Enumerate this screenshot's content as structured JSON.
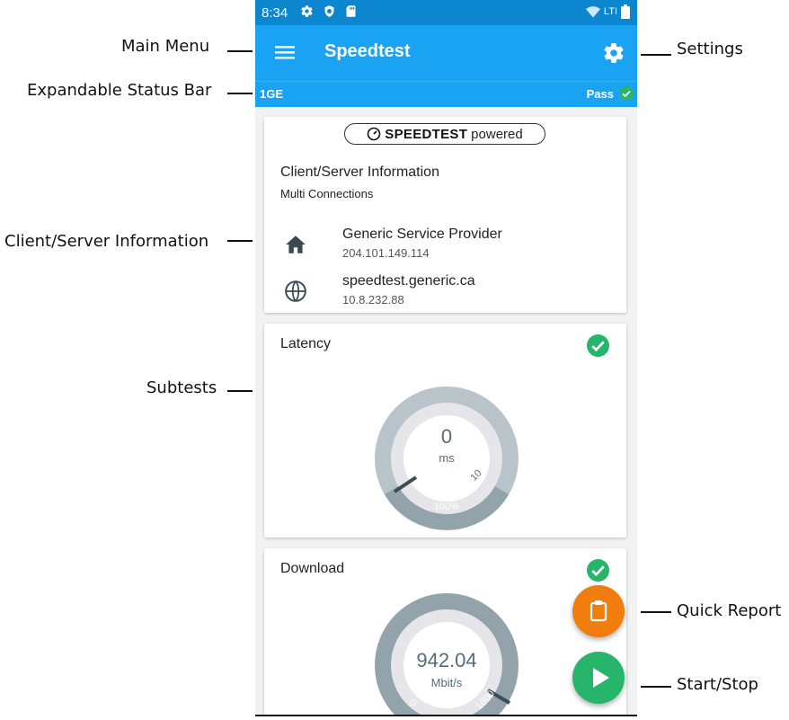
{
  "callouts": {
    "main_menu": "Main Menu",
    "settings": "Settings",
    "expandable_status_bar": "Expandable Status Bar",
    "client_server_information": "Client/Server Information",
    "subtests": "Subtests",
    "quick_report": "Quick Report",
    "start_stop": "Start/Stop"
  },
  "status_bar": {
    "time": "8:34",
    "icons": [
      "gear-icon",
      "shield-icon",
      "sd-card-icon"
    ],
    "network": "LTI",
    "right_icons": [
      "wifi-icon",
      "battery-icon"
    ]
  },
  "app_bar": {
    "title": "Speedtest",
    "menu_icon": "menu-icon",
    "settings_icon": "gear-icon"
  },
  "status_strip": {
    "left": "1GE",
    "right": "Pass"
  },
  "info_card": {
    "logo_brand": "SPEEDTEST",
    "logo_suffix": "powered",
    "title": "Client/Server Information",
    "subtitle": "Multi Connections",
    "client": {
      "name": "Generic Service Provider",
      "ip": "204.101.149.114",
      "icon": "home-icon"
    },
    "server": {
      "name": "speedtest.generic.ca",
      "ip": "10.8.232.88",
      "icon": "globe-icon"
    }
  },
  "latency_card": {
    "title": "Latency",
    "value": "0",
    "unit": "ms",
    "threshold_label": "10",
    "percent_label": "100%",
    "colors": {
      "track": "#b8c4c9",
      "inner": "#e6e6ea",
      "fill": "#93a3ab",
      "needle": "#3e4d55"
    }
  },
  "download_card": {
    "title": "Download",
    "value": "942.04",
    "unit": "Mbit/s",
    "min_label": "0",
    "threshold_label": "1000"
  },
  "fabs": {
    "quick_report_icon": "clipboard-icon",
    "start_stop_icon": "play-icon"
  },
  "colors": {
    "app_bar": "#1aa3f2",
    "status_bar": "#0c86cf",
    "pass_green": "#27b56b",
    "report_orange": "#f07d0e"
  }
}
